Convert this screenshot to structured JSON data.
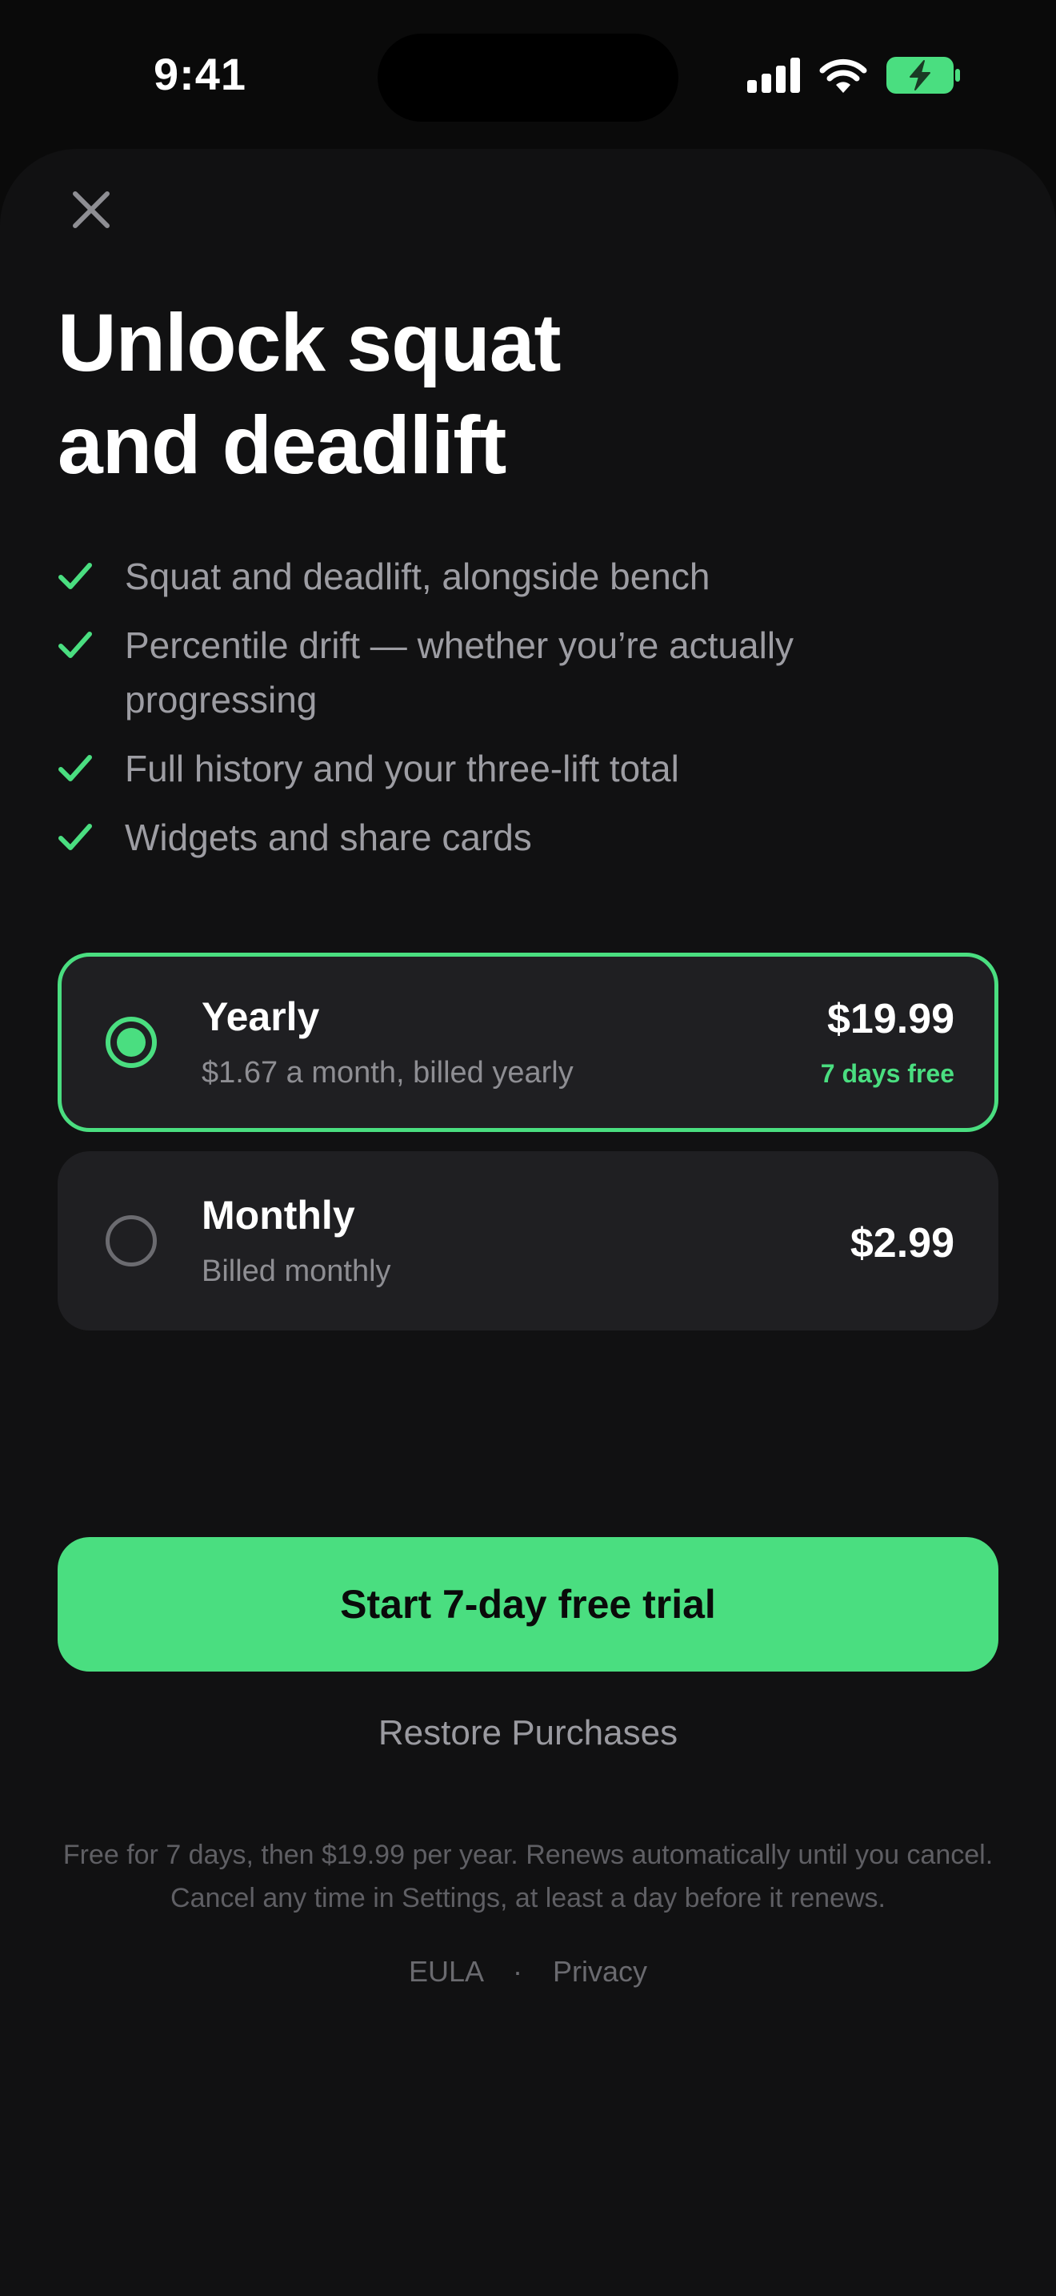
{
  "status_bar": {
    "time": "9:41",
    "icons": [
      "cellular-signal-icon",
      "wifi-icon",
      "battery-charging-icon"
    ],
    "battery_color": "#4ade80"
  },
  "paywall": {
    "close_icon": "close-icon",
    "title_line1": "Unlock squat",
    "title_line2": "and deadlift",
    "features": [
      {
        "icon": "checkmark-icon",
        "text": "Squat and deadlift, alongside bench"
      },
      {
        "icon": "checkmark-icon",
        "text": "Percentile drift — whether you’re actually progressing"
      },
      {
        "icon": "checkmark-icon",
        "text": "Full history and your three-lift total"
      },
      {
        "icon": "checkmark-icon",
        "text": "Widgets and share cards"
      }
    ],
    "plans": [
      {
        "name": "Yearly",
        "subtitle": "$1.67 a month, billed yearly",
        "price": "$19.99",
        "badge": "7 days free",
        "selected": true
      },
      {
        "name": "Monthly",
        "subtitle": "Billed monthly",
        "price": "$2.99",
        "badge": "",
        "selected": false
      }
    ],
    "cta_label": "Start 7-day free trial",
    "restore_label": "Restore Purchases",
    "legal_text": "Free for 7 days, then $19.99 per year. Renews automatically until you cancel. Cancel any time in Settings, at least a day before it renews.",
    "legal_links": {
      "eula": "EULA",
      "separator": "·",
      "privacy": "Privacy"
    }
  },
  "colors": {
    "accent": "#4ade80",
    "background": "#0a0a0a",
    "sheet": "#111112",
    "card": "#1f1f22"
  }
}
